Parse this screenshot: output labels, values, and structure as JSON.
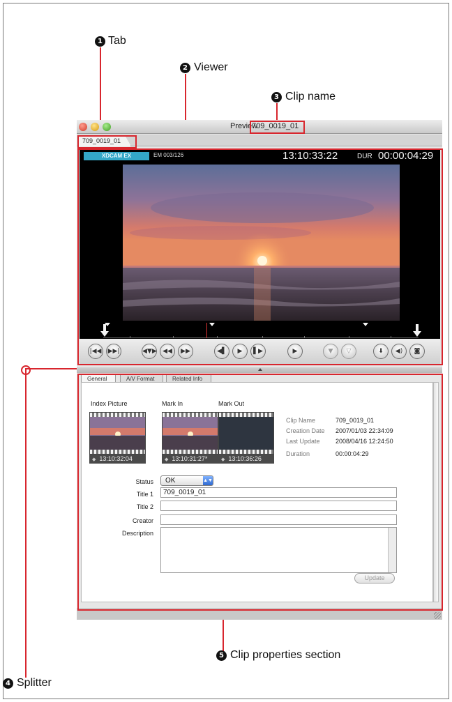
{
  "callouts": [
    {
      "num": "1",
      "label": "Tab"
    },
    {
      "num": "2",
      "label": "Viewer"
    },
    {
      "num": "3",
      "label": "Clip name"
    },
    {
      "num": "4",
      "label": "Splitter"
    },
    {
      "num": "5",
      "label": "Clip properties section"
    }
  ],
  "window": {
    "title": "Preview",
    "clip_name": "709_0019_01",
    "tab_label": "709_0019_01"
  },
  "viewer": {
    "badge": "XDCAM EX",
    "em_count": "EM 003/126",
    "timecode": "13:10:33:22",
    "dur_label": "DUR",
    "duration": "00:00:04:29"
  },
  "transport_buttons": [
    {
      "name": "goto-start-icon",
      "glyph": "|◀◀"
    },
    {
      "name": "goto-end-icon",
      "glyph": "▶▶|"
    },
    {
      "name": "prev-clip-icon",
      "glyph": "◀▼▶"
    },
    {
      "name": "prev-essence-mark-icon",
      "glyph": "◀◀"
    },
    {
      "name": "next-essence-mark-icon",
      "glyph": "▶▶"
    },
    {
      "name": "goto-in-point-icon",
      "glyph": "◀▌"
    },
    {
      "name": "play-in-out-icon",
      "glyph": "▶"
    },
    {
      "name": "goto-out-point-icon",
      "glyph": "▌▶"
    },
    {
      "name": "play-icon",
      "glyph": "▶"
    },
    {
      "name": "mark-in-icon",
      "glyph": "▼"
    },
    {
      "name": "mark-out-icon",
      "glyph": "▽"
    },
    {
      "name": "download-icon",
      "glyph": "⬇"
    },
    {
      "name": "audio-icon",
      "glyph": "◀)"
    },
    {
      "name": "camera-icon",
      "glyph": "◙"
    }
  ],
  "properties": {
    "tabs": [
      "General",
      "A/V Format",
      "Related Info"
    ],
    "index_picture_label": "Index Picture",
    "mark_in_label": "Mark In",
    "mark_out_label": "Mark Out",
    "index_tc": "13:10:32:04",
    "mark_in_tc": "13:10:31:27*",
    "mark_out_tc": "13:10:36:26",
    "info": [
      {
        "key": "Clip Name",
        "value": "709_0019_01"
      },
      {
        "key": "Creation Date",
        "value": "2007/01/03 22:34:09"
      },
      {
        "key": "Last Update",
        "value": "2008/04/16 12:24:50"
      },
      {
        "key": "Duration",
        "value": "00:00:04:29"
      }
    ],
    "status_label": "Status",
    "status_value": "OK",
    "title1_label": "Title 1",
    "title1_value": "709_0019_01",
    "title2_label": "Title 2",
    "title2_value": "",
    "creator_label": "Creator",
    "creator_value": "",
    "description_label": "Description",
    "description_value": "",
    "update_label": "Update"
  },
  "colors": {
    "callout_red": "#d8262e",
    "badge_blue": "#34a7c8"
  }
}
